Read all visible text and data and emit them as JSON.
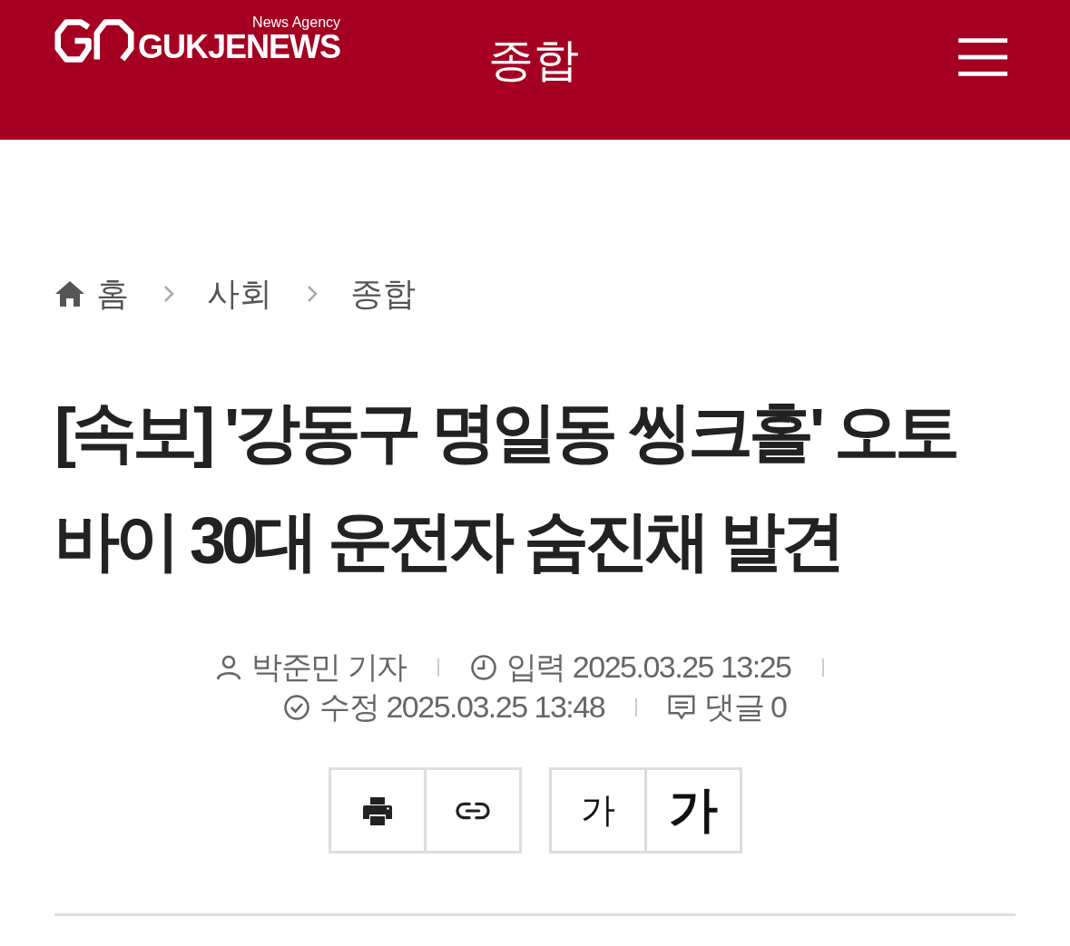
{
  "header": {
    "logo_text": "GUKJENEWS",
    "logo_tagline": "News Agency",
    "section_title": "종합"
  },
  "breadcrumb": [
    {
      "label": "홈",
      "kind": "home"
    },
    {
      "label": "사회",
      "kind": "page"
    },
    {
      "label": "종합",
      "kind": "page"
    }
  ],
  "headline": "[속보] '강동구 명일동 씽크홀' 오토바이 30대 운전자 숨진채 발견",
  "meta": {
    "lines": [
      {
        "items": [
          {
            "kind": "author",
            "text": "박준민 기자"
          },
          {
            "kind": "created",
            "text": "입력 2025.03.25 13:25"
          }
        ]
      },
      {
        "items": [
          {
            "kind": "modified",
            "text": "수정 2025.03.25 13:48"
          },
          {
            "kind": "comments",
            "text": "댓글 0"
          }
        ]
      }
    ]
  },
  "tools": [
    {
      "kind": "print"
    },
    {
      "kind": "link"
    }
  ],
  "font_buttons": [
    {
      "label": "가",
      "kind": "small"
    },
    {
      "label": "가",
      "kind": "large"
    }
  ]
}
